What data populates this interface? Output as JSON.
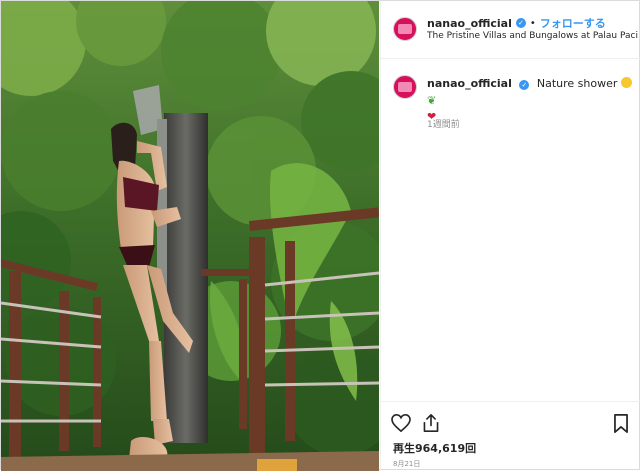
{
  "header": {
    "username": "nanao_official",
    "verified_mark": "✓",
    "separator": "•",
    "follow_label": "フォローする",
    "location": "The Pristine Villas and Bungalows at Palau Paci..."
  },
  "caption": {
    "username": "nanao_official",
    "text": "Nature shower",
    "emojis": [
      "smiling-face",
      "leaf",
      "heart"
    ],
    "leaf_glyph": "❦",
    "heart_glyph": "❤",
    "time_ago": "1週間前"
  },
  "actions": {
    "views": "再生964,619回",
    "date": "8月21日"
  },
  "icons": {
    "like": "heart-outline-icon",
    "share": "share-icon",
    "save": "bookmark-icon"
  },
  "colors": {
    "link_blue": "#3897f0",
    "verified_blue": "#3897f0",
    "avatar_pink": "#d8105c",
    "muted_text": "#8e8e8e",
    "foliage_green": "#3e7a2c",
    "railing_wood": "#6b3a26"
  }
}
